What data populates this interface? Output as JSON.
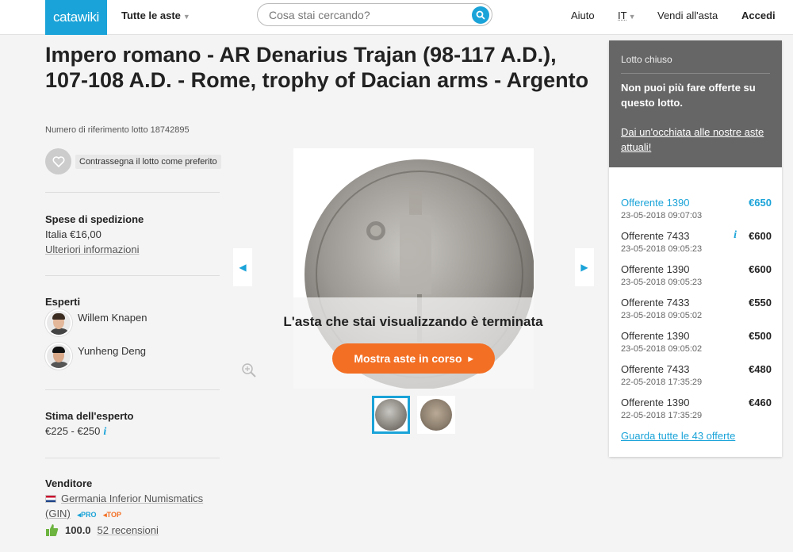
{
  "header": {
    "logo": "catawiki",
    "all_auctions": "Tutte le aste",
    "search_placeholder": "Cosa stai cercando?",
    "help": "Aiuto",
    "language": "IT",
    "sell": "Vendi all'asta",
    "login": "Accedi"
  },
  "lot": {
    "title": "Impero romano - AR Denarius Trajan (98-117 A.D.), 107-108 A.D. - Rome, trophy of Dacian arms - Argento",
    "reference": "Numero di riferimento lotto 18742895",
    "favorite_label": "Contrassegna il lotto come preferito"
  },
  "shipping": {
    "title": "Spese di spedizione",
    "value": "Italia €16,00",
    "more": "Ulteriori informazioni"
  },
  "experts": {
    "title": "Esperti",
    "items": [
      {
        "name": "Willem Knapen"
      },
      {
        "name": "Yunheng Deng"
      }
    ]
  },
  "estimate": {
    "title": "Stima dell'esperto",
    "value": "€225 - €250"
  },
  "seller": {
    "title": "Venditore",
    "name_line1": "Germania Inferior Numismatics",
    "name_line2": "(GIN)",
    "badge_pro": "PRO",
    "badge_top": "TOP",
    "score": "100.0",
    "reviews": "52 recensioni",
    "colors": {
      "pro": "#1aa3d8",
      "top": "#f36f24",
      "thumb": "#6cb33f"
    }
  },
  "gallery": {
    "ended_text": "L'asta che stai visualizzando è terminata",
    "live_button": "Mostra aste in corso"
  },
  "panel": {
    "closed_title": "Lotto chiuso",
    "closed_message": "Non puoi più fare offerte su questo lotto.",
    "closed_link": "Dai un'occhiata alle nostre aste attuali!",
    "bids": [
      {
        "bidder": "Offerente 1390",
        "time": "23-05-2018 09:07:03",
        "amount": "€650"
      },
      {
        "bidder": "Offerente 7433",
        "time": "23-05-2018 09:05:23",
        "amount": "€600"
      },
      {
        "bidder": "Offerente 1390",
        "time": "23-05-2018 09:05:23",
        "amount": "€600"
      },
      {
        "bidder": "Offerente 7433",
        "time": "23-05-2018 09:05:02",
        "amount": "€550"
      },
      {
        "bidder": "Offerente 1390",
        "time": "23-05-2018 09:05:02",
        "amount": "€500"
      },
      {
        "bidder": "Offerente 7433",
        "time": "22-05-2018 17:35:29",
        "amount": "€480"
      },
      {
        "bidder": "Offerente 1390",
        "time": "22-05-2018 17:35:29",
        "amount": "€460"
      }
    ],
    "all_bids_link": "Guarda tutte le 43 offerte"
  },
  "colors": {
    "brand": "#1aa3d8",
    "accent": "#f36f24",
    "panel_closed": "#666666"
  }
}
